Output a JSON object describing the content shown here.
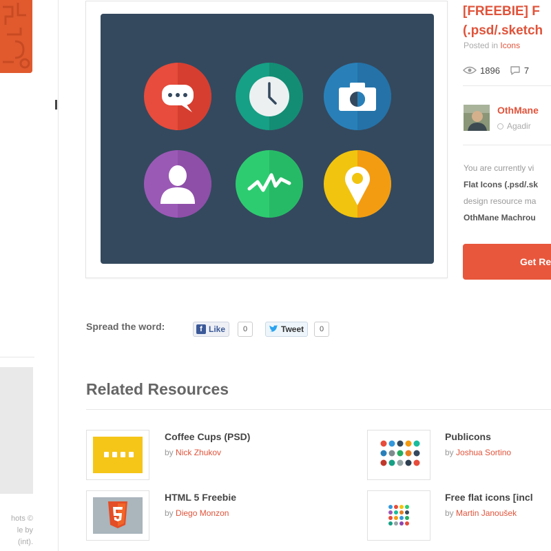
{
  "sidebar_left": {
    "credit_lines": [
      "hots ©",
      "le by",
      "(int)."
    ]
  },
  "preview": {
    "background_color": "#34495e",
    "icons": [
      {
        "name": "chat-bubble-icon",
        "color": "#e74c3c"
      },
      {
        "name": "clock-icon",
        "color": "#16a085"
      },
      {
        "name": "camera-icon",
        "color": "#2980b9"
      },
      {
        "name": "user-icon",
        "color": "#9b59b6"
      },
      {
        "name": "activity-icon",
        "color": "#2ecc71"
      },
      {
        "name": "map-pin-icon",
        "color": "#f1c40f"
      }
    ]
  },
  "resource": {
    "title_line1": "[FREEBIE] F",
    "title_line2": "(.psd/.sketch",
    "posted_prefix": "Posted in",
    "category": "Icons",
    "views": "1896",
    "comments": "7"
  },
  "author": {
    "name": "OthMane",
    "location": "Agadir"
  },
  "description": {
    "line1": "You are currently vi",
    "line2": "Flat Icons (.psd/.sk",
    "line3": "design resource ma",
    "line4": "OthMane Machrou"
  },
  "cta": {
    "label": "Get Re"
  },
  "share": {
    "label": "Spread the word:",
    "like_label": "Like",
    "like_count": "0",
    "tweet_label": "Tweet",
    "tweet_count": "0"
  },
  "related": {
    "title": "Related Resources",
    "by_label": "by",
    "items": [
      {
        "title": "Coffee Cups (PSD)",
        "author": "Nick Zhukov"
      },
      {
        "title": "Publicons",
        "author": "Joshua Sortino"
      },
      {
        "title": "HTML 5 Freebie",
        "author": "Diego Monzon"
      },
      {
        "title": "Free flat icons [incl",
        "author": "Martin Janoušek"
      }
    ]
  },
  "colors": {
    "accent": "#e0533a",
    "button": "#e8573c"
  }
}
